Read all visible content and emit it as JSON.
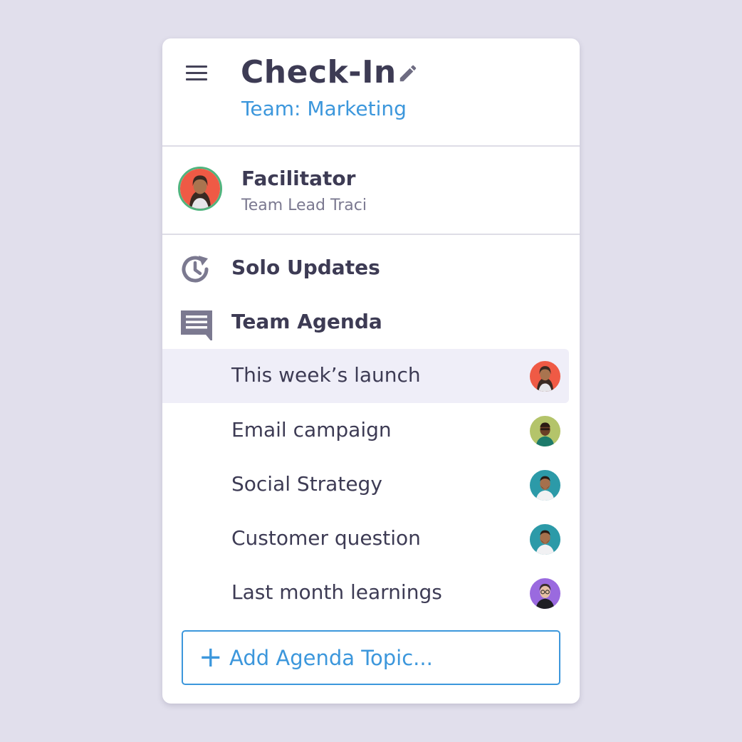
{
  "header": {
    "title": "Check-In",
    "subtitle": "Team: Marketing"
  },
  "facilitator": {
    "label": "Facilitator",
    "name": "Team Lead Traci"
  },
  "sections": {
    "solo_updates": "Solo Updates",
    "team_agenda": "Team Agenda"
  },
  "agenda_items": [
    {
      "label": "This week’s launch",
      "active": true,
      "avatar_color": "#ef5a45"
    },
    {
      "label": "Email campaign",
      "active": false,
      "avatar_color": "#b4c46a"
    },
    {
      "label": "Social Strategy",
      "active": false,
      "avatar_color": "#2c9aa8"
    },
    {
      "label": "Customer question",
      "active": false,
      "avatar_color": "#2c9aa8"
    },
    {
      "label": "Last month learnings",
      "active": false,
      "avatar_color": "#9a6adf"
    }
  ],
  "add_button": {
    "label": "Add Agenda Topic..."
  },
  "icons": {
    "menu": "menu-icon",
    "edit": "pencil-icon",
    "solo_updates": "clock-refresh-icon",
    "team_agenda": "chat-icon",
    "add": "plus-icon"
  },
  "colors": {
    "accent": "#3c97dc",
    "text_primary": "#3d3b54",
    "text_secondary": "#7b7990",
    "active_row": "#efeef8",
    "facilitator_ring": "#50b47e",
    "page_background": "#e1dfec"
  }
}
